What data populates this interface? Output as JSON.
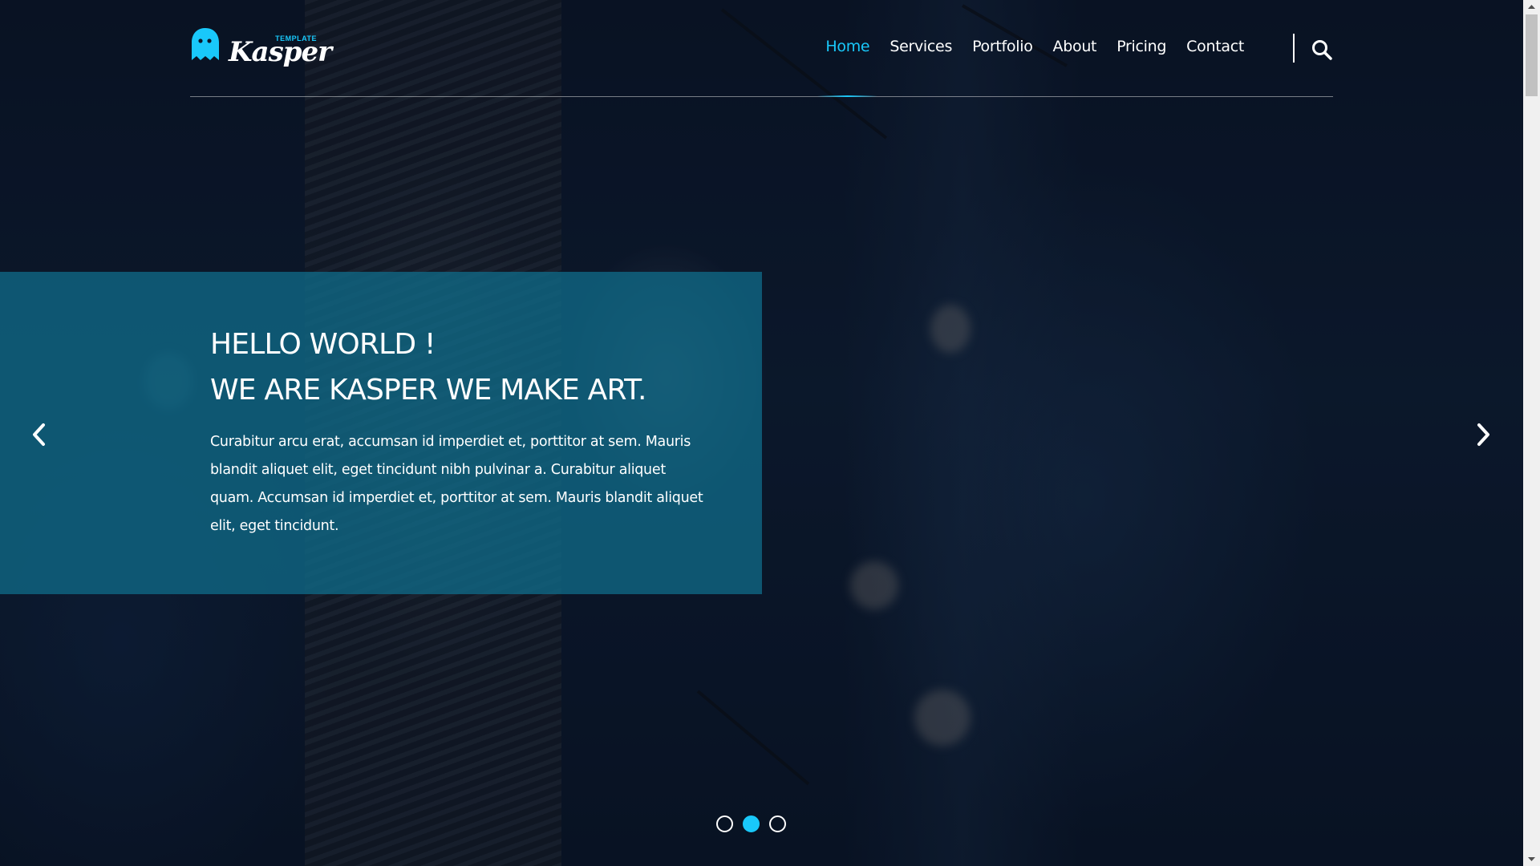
{
  "brand": {
    "logo_small": "TEMPLATE",
    "logo_main": "Kasper",
    "accent": "#19c8fa"
  },
  "nav": {
    "items": [
      {
        "label": "Home",
        "active": true
      },
      {
        "label": "Services"
      },
      {
        "label": "Portfolio"
      },
      {
        "label": "About"
      },
      {
        "label": "Pricing"
      },
      {
        "label": "Contact"
      }
    ],
    "search_icon": "search-icon"
  },
  "slide": {
    "title_line1": "HELLO WORLD !",
    "title_line2": "WE ARE KASPER WE MAKE ART.",
    "body": "Curabitur arcu erat, accumsan id imperdiet et, porttitor at sem. Mauris blandit aliquet elit, eget tincidunt nibh pulvinar a. Curabitur aliquet quam. Accumsan id imperdiet et, porttitor at sem. Mauris blandit aliquet elit, eget tincidunt."
  },
  "carousel": {
    "prev_icon": "chevron-left-icon",
    "next_icon": "chevron-right-icon",
    "slides": 3,
    "active_index": 1
  }
}
